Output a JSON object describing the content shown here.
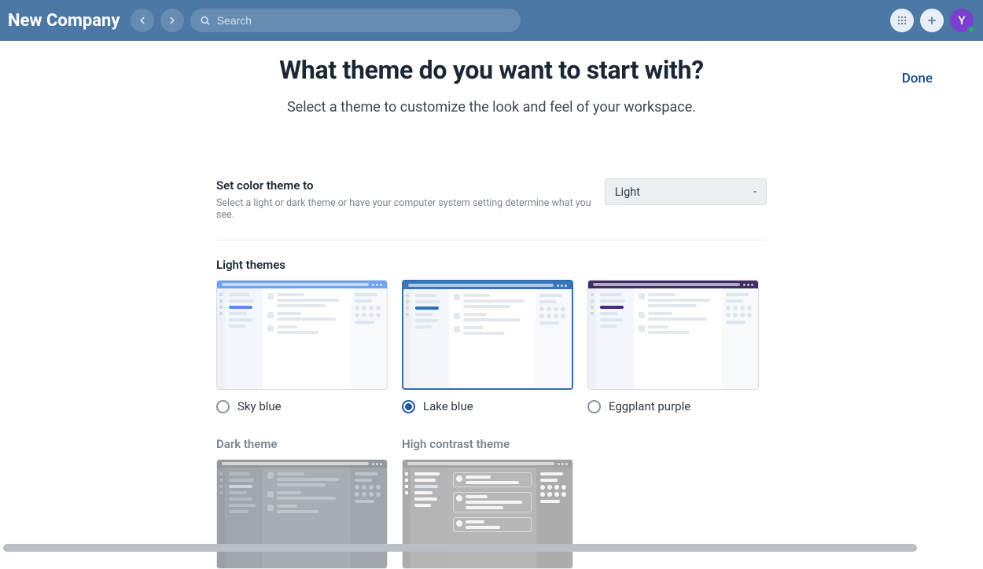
{
  "topbar": {
    "company_name": "New Company",
    "search_placeholder": "Search",
    "avatar_initial": "Y"
  },
  "page": {
    "heading": "What theme do you want to start with?",
    "subheading": "Select a theme to customize the look and feel of your workspace.",
    "done_label": "Done"
  },
  "color_mode": {
    "label": "Set color theme to",
    "description": "Select a light or dark theme or have your computer system setting determine what you see.",
    "selected": "Light"
  },
  "sections": {
    "light_title": "Light themes",
    "dark_title": "Dark theme",
    "hc_title": "High contrast theme"
  },
  "themes_light": [
    {
      "id": "sky",
      "label": "Sky blue",
      "selected": false
    },
    {
      "id": "lake",
      "label": "Lake blue",
      "selected": true
    },
    {
      "id": "egg",
      "label": "Eggplant purple",
      "selected": false
    }
  ],
  "colors": {
    "topbar": "#4c78a5",
    "done_link": "#1a4a8a",
    "accent_sky": "#5b8def",
    "accent_lake": "#2f6fb0",
    "accent_eggplant": "#4a2b7a",
    "avatar": "#7b3fcf",
    "presence": "#27ae60"
  }
}
